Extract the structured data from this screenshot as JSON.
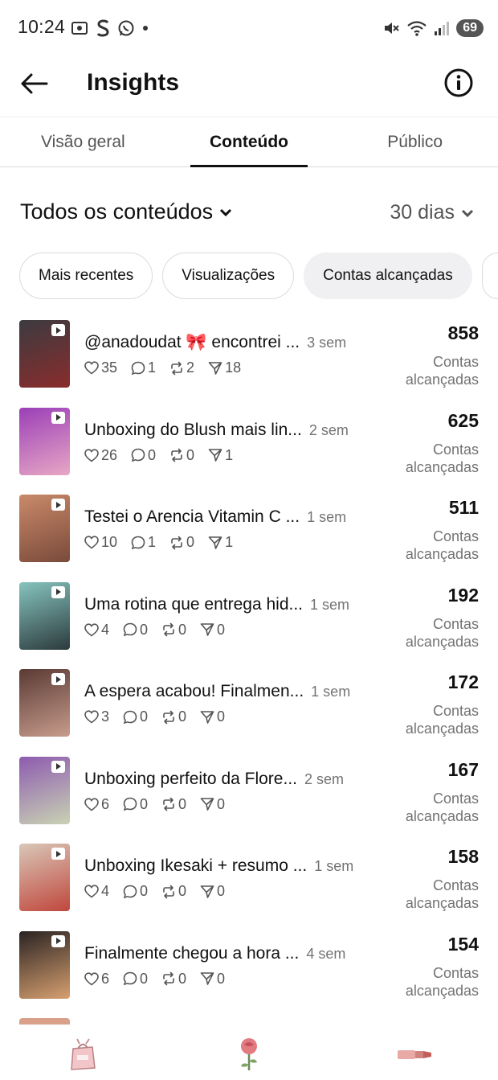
{
  "status_bar": {
    "time": "10:24",
    "battery": "69",
    "icons": [
      "screenshot-icon",
      "s-app-icon",
      "whatsapp-icon",
      "dot-icon",
      "mute-icon",
      "wifi-icon",
      "signal-icon"
    ]
  },
  "header": {
    "title": "Insights"
  },
  "tabs": [
    {
      "label": "Visão geral",
      "active": false
    },
    {
      "label": "Conteúdo",
      "active": true
    },
    {
      "label": "Público",
      "active": false
    }
  ],
  "filters": {
    "content_type": "Todos os conteúdos",
    "period": "30 dias"
  },
  "chips": [
    {
      "label": "Mais recentes",
      "selected": false
    },
    {
      "label": "Visualizações",
      "selected": false
    },
    {
      "label": "Contas alcançadas",
      "selected": true
    }
  ],
  "posts": [
    {
      "title": "@anadoudat 🎀 encontrei ...",
      "age": "3 sem",
      "likes": "35",
      "comments": "1",
      "reposts": "2",
      "shares": "18",
      "value": "858",
      "metric": "Contas alcançadas",
      "thumb_colors": [
        "#3b3b40",
        "#8a2c2c"
      ]
    },
    {
      "title": "Unboxing do Blush mais lin...",
      "age": "2 sem",
      "likes": "26",
      "comments": "0",
      "reposts": "0",
      "shares": "1",
      "value": "625",
      "metric": "Contas alcançadas",
      "thumb_colors": [
        "#9b3fb8",
        "#e7a7c4"
      ]
    },
    {
      "title": "Testei o Arencia Vitamin C ...",
      "age": "1 sem",
      "likes": "10",
      "comments": "1",
      "reposts": "0",
      "shares": "1",
      "value": "511",
      "metric": "Contas alcançadas",
      "thumb_colors": [
        "#c98a6a",
        "#7a4a3a"
      ]
    },
    {
      "title": "Uma rotina que entrega hid...",
      "age": "1 sem",
      "likes": "4",
      "comments": "0",
      "reposts": "0",
      "shares": "0",
      "value": "192",
      "metric": "Contas alcançadas",
      "thumb_colors": [
        "#86c4bf",
        "#2c3a3c"
      ]
    },
    {
      "title": "A espera acabou! Finalmen...",
      "age": "1 sem",
      "likes": "3",
      "comments": "0",
      "reposts": "0",
      "shares": "0",
      "value": "172",
      "metric": "Contas alcançadas",
      "thumb_colors": [
        "#5a3a34",
        "#c79c8c"
      ]
    },
    {
      "title": "Unboxing perfeito da Flore...",
      "age": "2 sem",
      "likes": "6",
      "comments": "0",
      "reposts": "0",
      "shares": "0",
      "value": "167",
      "metric": "Contas alcançadas",
      "thumb_colors": [
        "#8d5bb0",
        "#c9d2b3"
      ]
    },
    {
      "title": "Unboxing Ikesaki + resumo ...",
      "age": "1 sem",
      "likes": "4",
      "comments": "0",
      "reposts": "0",
      "shares": "0",
      "value": "158",
      "metric": "Contas alcançadas",
      "thumb_colors": [
        "#d9c7b8",
        "#c0473c"
      ]
    },
    {
      "title": "Finalmente chegou a hora ...",
      "age": "4 sem",
      "likes": "6",
      "comments": "0",
      "reposts": "0",
      "shares": "0",
      "value": "154",
      "metric": "Contas alcançadas",
      "thumb_colors": [
        "#2a2322",
        "#d7a070"
      ]
    }
  ],
  "bottom_bar": {
    "items": [
      "gift-bag-icon",
      "rose-icon",
      "lipstick-icon"
    ]
  }
}
